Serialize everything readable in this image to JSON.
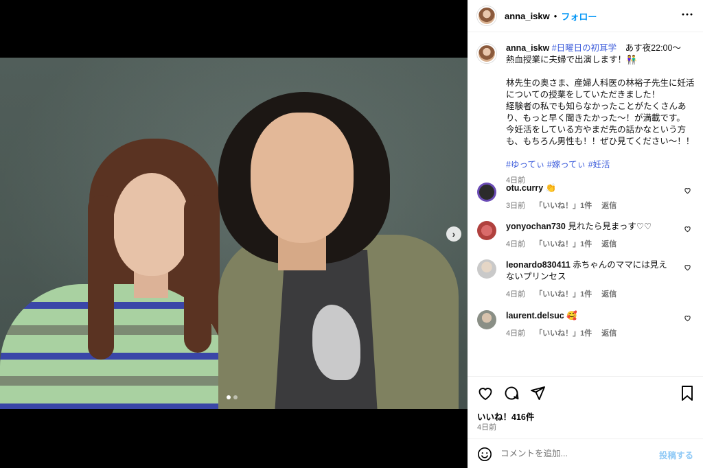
{
  "header": {
    "username": "anna_iskw",
    "separator": "•",
    "follow_label": "フォロー",
    "more_icon": "more-horizontal-icon"
  },
  "caption": {
    "username": "anna_iskw",
    "hashtag1": "#日曜日の初耳学",
    "line1_rest": "　あす夜22:00〜",
    "line2": "熱血授業に夫婦で出演します！👫",
    "line3": "林先生の奥さま、産婦人科医の林裕子先生に妊活",
    "line4": "についての授業をしていただきました！",
    "line5": "経験者の私でも知らなかったことがたくさんあ",
    "line6": "り、もっと早く聞きたかった〜！が満載です。",
    "line7": "今妊活をしている方やまだ先の話かなという方",
    "line8": "も、もちろん男性も！！ぜひ見てください〜！！",
    "hashtags": "#ゆってぃ #嫁ってぃ #妊活",
    "time": "4日前"
  },
  "comments": [
    {
      "username": "otu.curry",
      "text": "👏",
      "time": "3日前",
      "likes": "「いいね！」1件",
      "reply": "返信",
      "avatar_color": "#6a4bb5"
    },
    {
      "username": "yonyochan730",
      "text": "見れたら見まっす♡♡",
      "time": "4日前",
      "likes": "「いいね！」1件",
      "reply": "返信",
      "avatar_color": "#b0413e"
    },
    {
      "username": "leonardo830411",
      "text": "赤ちゃんのママには見えないプリンセス",
      "time": "4日前",
      "likes": "「いいね！」1件",
      "reply": "返信",
      "avatar_color": "#c9c9c9"
    },
    {
      "username": "laurent.delsuc",
      "text": "🥰",
      "time": "4日前",
      "likes": "「いいね！」1件",
      "reply": "返信",
      "avatar_color": "#8a8f86"
    }
  ],
  "actions": {
    "likes_text": "いいね！416件",
    "date": "4日前",
    "comment_placeholder": "コメントを追加...",
    "post_label": "投稿する"
  },
  "media": {
    "next_icon": "chevron-right-icon",
    "carousel_total": 2,
    "carousel_active": 1
  }
}
